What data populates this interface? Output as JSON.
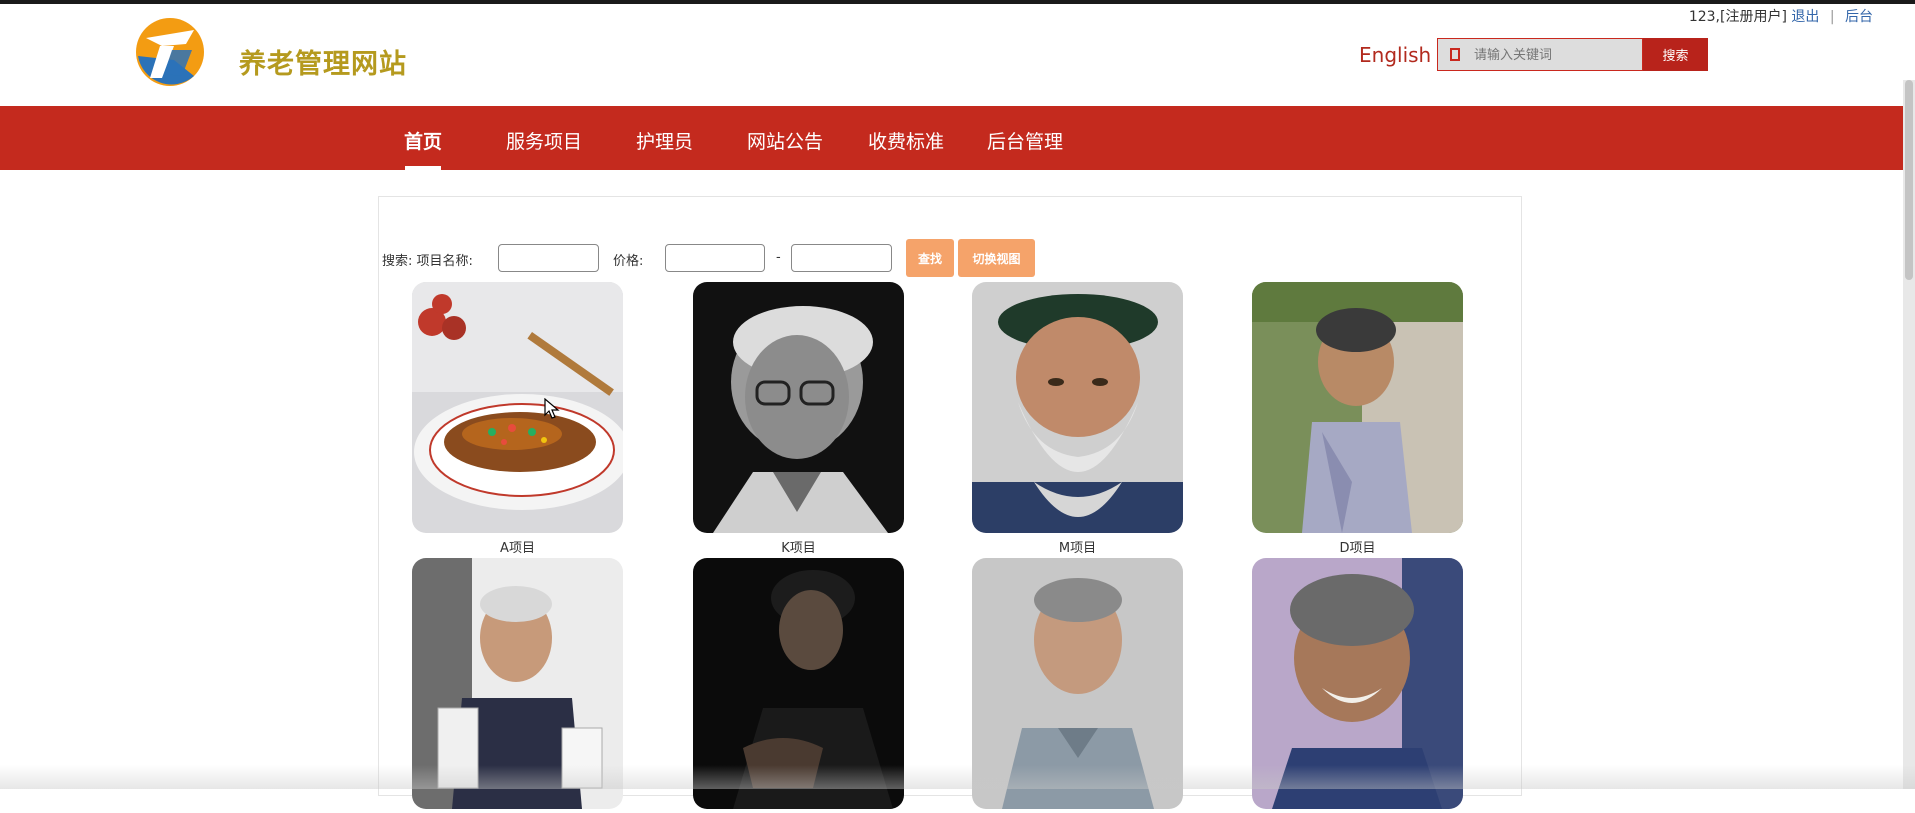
{
  "header": {
    "site_title": "养老管理网站",
    "user_text": "123,[注册用户]",
    "logout": "退出",
    "separator": "|",
    "admin": "后台",
    "lang": "English",
    "search_placeholder": "请输入关键词",
    "search_button": "搜索"
  },
  "nav": {
    "items": [
      {
        "label": "首页",
        "active": true
      },
      {
        "label": "服务项目",
        "active": false
      },
      {
        "label": "护理员",
        "active": false
      },
      {
        "label": "网站公告",
        "active": false
      },
      {
        "label": "收费标准",
        "active": false
      },
      {
        "label": "后台管理",
        "active": false
      }
    ]
  },
  "filter": {
    "search_label": "搜索: 项目名称:",
    "price_label": "价格:",
    "dash": "-",
    "find_button": "查找",
    "switch_button": "切换视图"
  },
  "cards": [
    {
      "caption": "A项目",
      "image": "fish-dish"
    },
    {
      "caption": "K项目",
      "image": "elderly-man-glasses-bw"
    },
    {
      "caption": "M项目",
      "image": "elderly-man-white-beard"
    },
    {
      "caption": "D项目",
      "image": "elderly-woman-outdoors"
    },
    {
      "caption": "",
      "image": "elderly-man-holding-papers"
    },
    {
      "caption": "",
      "image": "elderly-woman-dark"
    },
    {
      "caption": "",
      "image": "elderly-man-portrait"
    },
    {
      "caption": "",
      "image": "elderly-woman-smiling"
    }
  ],
  "colors": {
    "brand_red": "#c42a1e",
    "title_gold": "#b59a1e",
    "button_orange": "#f5a36a"
  }
}
